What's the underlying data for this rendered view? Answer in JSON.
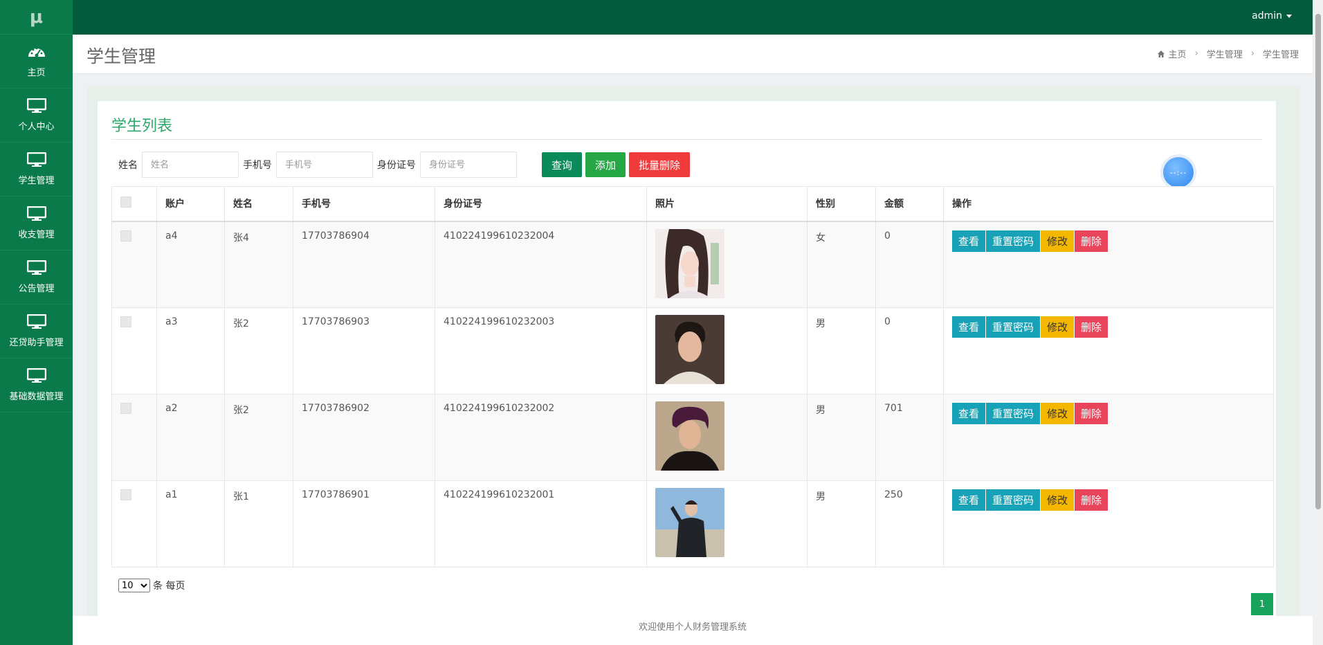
{
  "brand": {
    "logo": "μ"
  },
  "sidebar": {
    "items": [
      {
        "label": "主页",
        "icon": "dashboard-icon"
      },
      {
        "label": "个人中心",
        "icon": "monitor-icon"
      },
      {
        "label": "学生管理",
        "icon": "monitor-icon"
      },
      {
        "label": "收支管理",
        "icon": "monitor-icon"
      },
      {
        "label": "公告管理",
        "icon": "monitor-icon"
      },
      {
        "label": "还贷助手管理",
        "icon": "monitor-icon"
      },
      {
        "label": "基础数据管理",
        "icon": "monitor-icon"
      }
    ]
  },
  "topbar": {
    "user": "admin"
  },
  "header": {
    "title": "学生管理",
    "breadcrumb": [
      "主页",
      "学生管理",
      "学生管理"
    ]
  },
  "card": {
    "title": "学生列表"
  },
  "search": {
    "name_label": "姓名",
    "name_placeholder": "姓名",
    "phone_label": "手机号",
    "phone_placeholder": "手机号",
    "id_label": "身份证号",
    "id_placeholder": "身份证号",
    "query": "查询",
    "add": "添加",
    "batch_delete": "批量删除"
  },
  "table": {
    "headers": [
      "账户",
      "姓名",
      "手机号",
      "身份证号",
      "照片",
      "性别",
      "金额",
      "操作"
    ],
    "actions": {
      "view": "查看",
      "reset": "重置密码",
      "edit": "修改",
      "delete": "删除"
    },
    "rows": [
      {
        "account": "a4",
        "name": "张4",
        "phone": "17703786904",
        "idcard": "410224199610232004",
        "gender": "女",
        "amount": "0"
      },
      {
        "account": "a3",
        "name": "张2",
        "phone": "17703786903",
        "idcard": "410224199610232003",
        "gender": "男",
        "amount": "0"
      },
      {
        "account": "a2",
        "name": "张2",
        "phone": "17703786902",
        "idcard": "410224199610232002",
        "gender": "男",
        "amount": "701"
      },
      {
        "account": "a1",
        "name": "张1",
        "phone": "17703786901",
        "idcard": "410224199610232001",
        "gender": "男",
        "amount": "250"
      }
    ]
  },
  "pager": {
    "page_size": "10",
    "per_page_label": "条 每页",
    "current_page": "1"
  },
  "footer": {
    "text": "欢迎使用个人财务管理系统"
  },
  "colors": {
    "sidebar": "#0a7a4a",
    "topbar": "#015b3c",
    "accent": "#2ea86a"
  }
}
